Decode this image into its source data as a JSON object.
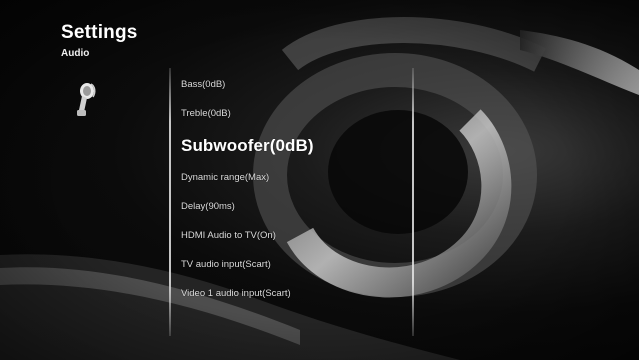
{
  "header": {
    "title": "Settings",
    "subtitle": "Audio"
  },
  "category_icon": "audio-settings-icon",
  "menu": {
    "items": [
      {
        "label": "Bass(0dB)",
        "selected": false
      },
      {
        "label": "Treble(0dB)",
        "selected": false
      },
      {
        "label": "Subwoofer(0dB)",
        "selected": true
      },
      {
        "label": "Dynamic range(Max)",
        "selected": false
      },
      {
        "label": "Delay(90ms)",
        "selected": false
      },
      {
        "label": "HDMI Audio to TV(On)",
        "selected": false
      },
      {
        "label": "TV audio input(Scart)",
        "selected": false
      },
      {
        "label": "Video 1 audio input(Scart)",
        "selected": false
      }
    ]
  },
  "colors": {
    "background": "#0a0a0a",
    "text": "#dcdcdc",
    "selected_text": "#ffffff"
  }
}
